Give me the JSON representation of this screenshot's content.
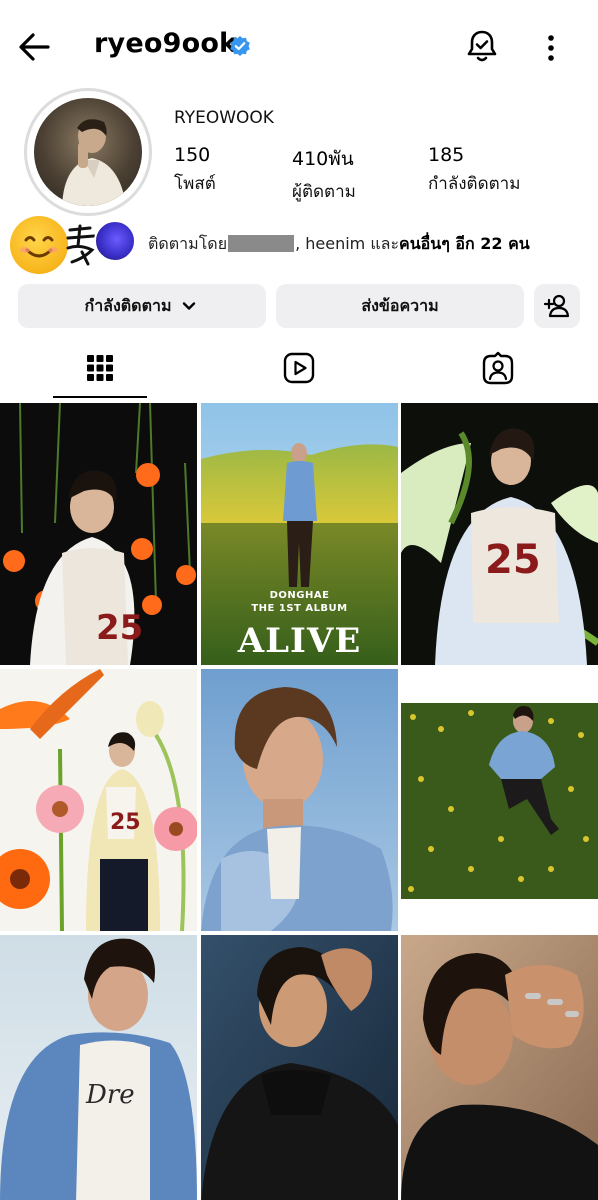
{
  "header": {
    "username": "ryeo9ook",
    "icons": {
      "back": "arrow-left-icon",
      "verified": "verified-badge-icon",
      "notify": "bell-check-icon",
      "more": "more-vertical-icon"
    }
  },
  "profile": {
    "display_name": "RYEOWOOK",
    "stats": [
      {
        "value": "150",
        "label": "โพสต์"
      },
      {
        "value": "410พัน",
        "label": "ผู้ติดตาม"
      },
      {
        "value": "185",
        "label": "กำลังติดตาม"
      }
    ],
    "followed_by": {
      "prefix": "ติดตามโดย",
      "name_after_redaction": ", heenim",
      "connector": " และ",
      "others": "คนอื่นๆ อีก 22 คน"
    }
  },
  "actions": {
    "following_label": "กำลังติดตาม",
    "message_label": "ส่งข้อความ"
  },
  "tabs": [
    {
      "name": "posts",
      "icon": "grid-icon",
      "active": true
    },
    {
      "name": "reels",
      "icon": "reels-icon",
      "active": false
    },
    {
      "name": "tagged",
      "icon": "tagged-person-icon",
      "active": false
    }
  ],
  "album_post": {
    "artist_line": "DONGHAE",
    "album_line": "THE 1ST ALBUM",
    "title": "ALIVE"
  },
  "colors": {
    "verified": "#3797f0",
    "button_bg": "#efeff1"
  }
}
